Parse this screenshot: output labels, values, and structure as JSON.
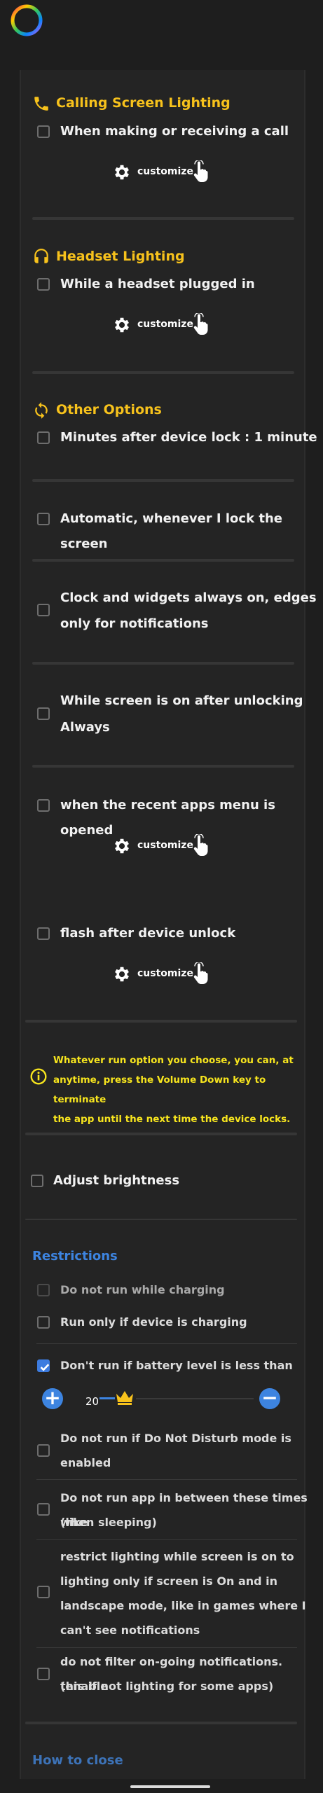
{
  "sections": {
    "calling": {
      "title": "Calling Screen Lighting",
      "option": "When making or receiving a call",
      "customize": "customize"
    },
    "headset": {
      "title": "Headset Lighting",
      "option": "While a headset plugged in",
      "customize": "customize"
    },
    "other": {
      "title": "Other Options",
      "minutes": "Minutes after device lock : 1 minute",
      "automatic": "Automatic, whenever I lock the screen",
      "clock_line1": "Clock and widgets always on, edges",
      "clock_line2": "only for notifications",
      "unlock_line1": "While screen is on after unlocking",
      "unlock_line2": "Always",
      "recent": "when the recent apps menu is opened",
      "recent_customize": "customize",
      "flash": "flash after device unlock",
      "flash_customize": "customize"
    }
  },
  "note": {
    "line1": "Whatever run option you choose, you can, at",
    "line2": "anytime, press the Volume Down key to terminate",
    "line3": "the app until the next time the device locks."
  },
  "brightness": "Adjust brightness",
  "restrictions": {
    "title": "Restrictions",
    "items": [
      {
        "text": "Do not run while charging",
        "checked": false
      },
      {
        "text": "Run only if device is charging",
        "checked": false
      },
      {
        "text": "Don't run if battery level is less than",
        "checked": true
      },
      {
        "line1": "Do not run if Do Not Disturb mode is",
        "line2": "enabled",
        "checked": false
      },
      {
        "line1": "Do not run app in between these times (like",
        "line2": "when sleeping)",
        "checked": false
      },
      {
        "line1": "restrict lighting while screen is on to",
        "line2": "lighting only if screen is On and in",
        "line3": "landscape mode, like in games where I",
        "line4": "can't see notifications",
        "checked": false
      },
      {
        "line1": "do not filter on-going notifications. (enable",
        "line2": "this if not lighting for some apps)",
        "checked": false
      }
    ],
    "battery_value": "20",
    "plus": "+",
    "minus": "−"
  },
  "how_to_close": "How to close",
  "colors": {
    "accent_yellow": "#f7c21c",
    "note_yellow": "#f7e51e",
    "accent_blue": "#3d84e0",
    "background": "#1e1e1e",
    "panel": "#242424"
  },
  "icons": [
    "rainbow-ring-logo",
    "phone-icon",
    "headphones-icon",
    "sync-icon",
    "gear-icon",
    "tap-hand-icon",
    "info-icon",
    "crown-icon"
  ]
}
